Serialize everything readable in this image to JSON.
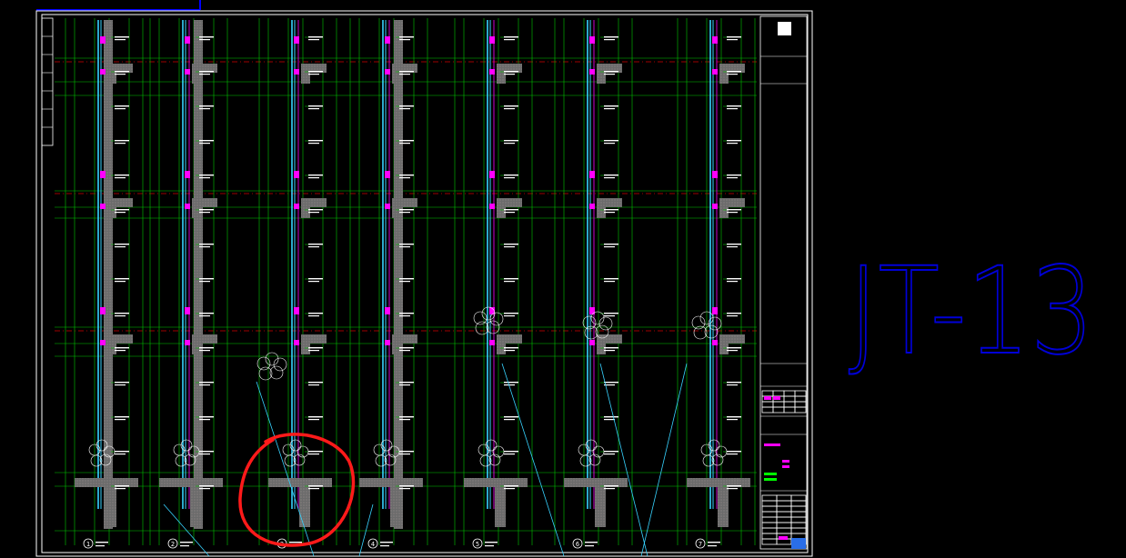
{
  "drawing": {
    "big_label": "JT-13",
    "detail_numbers": [
      "1",
      "2",
      "3",
      "4",
      "5",
      "6",
      "7"
    ],
    "colors": {
      "background": "#000000",
      "border": "#ffffff",
      "grid_green": "#00c800",
      "glass_cyan": "#37d3ff",
      "magenta": "#ff00ff",
      "concrete": "#6b6b6b",
      "axis_red": "#d20000",
      "highlight_red": "#ff1a1a",
      "big_label_blue": "#0000d8",
      "top_bar_blue": "#0000ff"
    }
  },
  "title_block": {
    "logo_icon": "white-square-logo-icon"
  }
}
